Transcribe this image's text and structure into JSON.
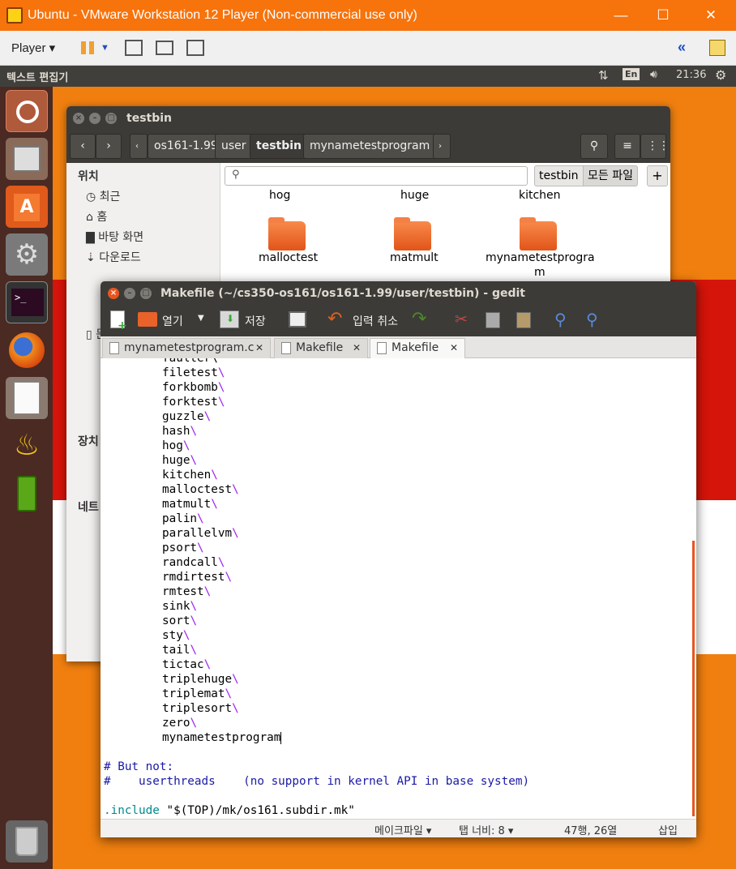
{
  "vmware": {
    "title": "Ubuntu - VMware Workstation 12 Player (Non-commercial use only)",
    "player_label": "Player ▾",
    "min": "—",
    "max": "☐",
    "close": "✕"
  },
  "panel": {
    "app_name": "텍스트 편집기",
    "keyboard": "En",
    "time": "21:36"
  },
  "nautilus": {
    "title": "testbin",
    "breadcrumbs": [
      "os161-1.99",
      "user",
      "testbin",
      "mynametestprogram"
    ],
    "search_tag": "testbin",
    "all_files": "모든 파일",
    "sidebar_heading_places": "위치",
    "sidebar": [
      "최근",
      "홈",
      "바탕 화면",
      "다운로드",
      "문서"
    ],
    "sidebar_heading_devices": "장치",
    "sidebar_heading_network": "네트",
    "top_files": [
      "hog",
      "huge",
      "kitchen"
    ],
    "folders": [
      "malloctest",
      "matmult",
      "mynametestprogra"
    ],
    "folder_wrap": "m"
  },
  "gedit": {
    "title": "Makefile (~/cs350-os161/os161-1.99/user/testbin) - gedit",
    "toolbar": {
      "open": "열기",
      "save": "저장",
      "undo": "입력 취소"
    },
    "tabs": [
      "mynametestprogram.c",
      "Makefile",
      "Makefile"
    ],
    "tab_close": "✕",
    "partial_first": "faulter\\",
    "lines": [
      "filetest",
      "forkbomb",
      "forktest",
      "guzzle",
      "hash",
      "hog",
      "huge",
      "kitchen",
      "malloctest",
      "matmult",
      "palin",
      "parallelvm",
      "psort",
      "randcall",
      "rmdirtest",
      "rmtest",
      "sink",
      "sort",
      "sty",
      "tail",
      "tictac",
      "triplehuge",
      "triplemat",
      "triplesort",
      "zero"
    ],
    "indent": "\t",
    "backslash": "\\",
    "last_line": "mynametestprogram",
    "comment1": "# But not:",
    "comment2": "#    userthreads    (no support in kernel API in base system)",
    "include_kw": ".include",
    "include_val": " \"$(TOP)/mk/os161.subdir.mk\"",
    "status": {
      "lang": "메이크파일 ▾",
      "tab": "탭 너비: 8 ▾",
      "pos": "47행, 26열",
      "mode": "삽입"
    }
  },
  "colors": {
    "ubuntu_orange": "#f7730c",
    "comment_blue": "#1a1aa6",
    "backslash_purple": "#a020f0",
    "keyword_teal": "#008a8c"
  }
}
